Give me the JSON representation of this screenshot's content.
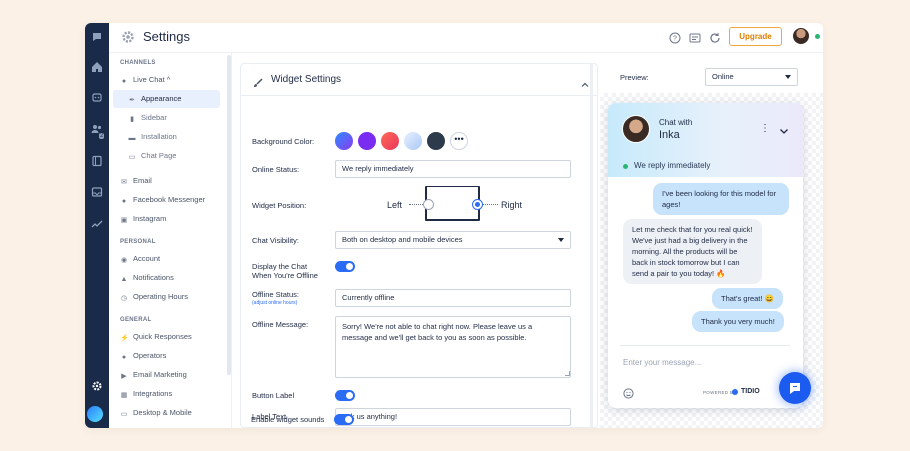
{
  "app": {
    "title": "Settings",
    "upgrade_label": "Upgrade"
  },
  "sidebar": {
    "channels_header": "CHANNELS",
    "personal_header": "PERSONAL",
    "general_header": "GENERAL",
    "channels": [
      {
        "label": "Live Chat ^",
        "icon": "chat-bubble-icon"
      },
      {
        "label": "Appearance",
        "icon": "brush-icon",
        "active": true
      },
      {
        "label": "Sidebar",
        "icon": "bookmark-icon"
      },
      {
        "label": "Installation",
        "icon": "code-icon"
      },
      {
        "label": "Chat Page",
        "icon": "monitor-icon"
      },
      {
        "label": "Email",
        "icon": "mail-icon"
      },
      {
        "label": "Facebook Messenger",
        "icon": "messenger-icon"
      },
      {
        "label": "Instagram",
        "icon": "instagram-icon"
      }
    ],
    "personal": [
      {
        "label": "Account",
        "icon": "user-circle-icon"
      },
      {
        "label": "Notifications",
        "icon": "bell-icon"
      },
      {
        "label": "Operating Hours",
        "icon": "clock-icon"
      }
    ],
    "general": [
      {
        "label": "Quick Responses",
        "icon": "bolt-icon"
      },
      {
        "label": "Operators",
        "icon": "users-icon"
      },
      {
        "label": "Email Marketing",
        "icon": "megaphone-icon"
      },
      {
        "label": "Integrations",
        "icon": "grid-icon"
      },
      {
        "label": "Desktop & Mobile",
        "icon": "devices-icon"
      }
    ]
  },
  "widget_settings": {
    "title": "Widget Settings",
    "background_color_label": "Background Color:",
    "swatches": [
      "#2f8bff",
      "#7a2cf0",
      "#f2505e",
      "#cfe3ff",
      "#2d3a4b"
    ],
    "online_status_label": "Online Status:",
    "online_status_value": "We reply immediately",
    "widget_position_label": "Widget Position:",
    "position_left": "Left",
    "position_right": "Right",
    "position_selected": "Right",
    "chat_visibility_label": "Chat Visibility:",
    "chat_visibility_value": "Both on desktop and mobile devices",
    "display_offline_label": "Display the Chat When You're Offline",
    "display_offline_on": true,
    "offline_status_label": "Offline Status:",
    "offline_status_link": "(adjust online hours)",
    "offline_status_value": "Currently offline",
    "offline_message_label": "Offline Message:",
    "offline_message_value": "Sorry! We're not able to chat right now. Please leave us a message and we'll get back to you as soon as possible.",
    "button_label_label": "Button Label",
    "button_label_on": true,
    "label_text_label": "Label Text",
    "label_text_value": "Ask us anything!",
    "sounds_label": "Enable widget sounds",
    "sounds_on": true
  },
  "preview": {
    "label": "Preview:",
    "mode": "Online",
    "chat": {
      "chat_with": "Chat with",
      "operator_name": "Inka",
      "status": "We reply immediately",
      "messages": [
        {
          "from": "user",
          "text": "I've been looking for this model for ages!"
        },
        {
          "from": "operator",
          "text": "Let me check that for you real quick! We've just had a big delivery in the morning. All the products will be back in stock tomorrow but I can send a pair to you today! 🔥"
        },
        {
          "from": "user",
          "text": "That's great! 😄"
        },
        {
          "from": "user",
          "text": "Thank you very much!"
        }
      ],
      "input_placeholder": "Enter your message...",
      "powered_by": "POWERED BY",
      "brand": "TIDIO"
    }
  }
}
